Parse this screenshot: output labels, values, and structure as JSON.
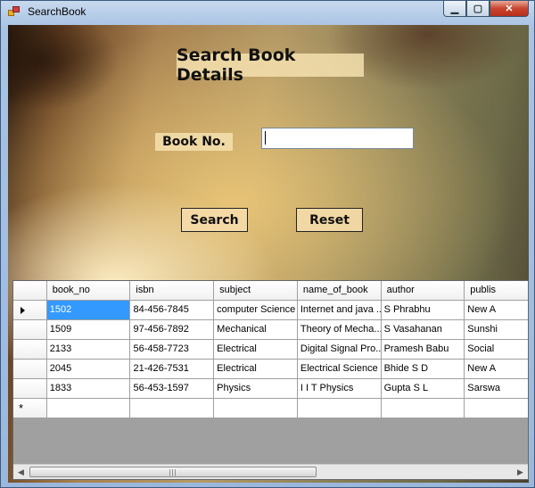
{
  "window": {
    "title": "SearchBook",
    "min_glyph": "▁",
    "max_glyph": "▢",
    "close_glyph": "✕"
  },
  "form": {
    "heading": "Search Book Details",
    "book_no_label": "Book No.",
    "book_no_value": "",
    "search_label": "Search",
    "reset_label": "Reset"
  },
  "grid": {
    "columns": [
      "book_no",
      "isbn",
      "subject",
      "name_of_book",
      "author",
      "publis"
    ],
    "rows": [
      [
        "1502",
        "84-456-7845",
        "computer Science",
        "Internet and java ...",
        "S Phrabhu",
        "New A"
      ],
      [
        "1509",
        "97-456-7892",
        "Mechanical",
        "Theory of Mecha...",
        "S Vasahanan",
        "Sunshi"
      ],
      [
        "2133",
        "56-458-7723",
        "Electrical",
        "Digital Signal Pro...",
        "Pramesh Babu",
        "Social"
      ],
      [
        "2045",
        "21-426-7531",
        "Electrical",
        "Electrical Science",
        "Bhide S D",
        "New A"
      ],
      [
        "1833",
        "56-453-1597",
        "Physics",
        "I I T Physics",
        "Gupta S L",
        "Sarswa"
      ]
    ],
    "new_row_glyph": "*",
    "scroll_thumb_glyph": "|||"
  },
  "colors": {
    "selection": "#3399ff",
    "accent": "#f5e1af"
  }
}
